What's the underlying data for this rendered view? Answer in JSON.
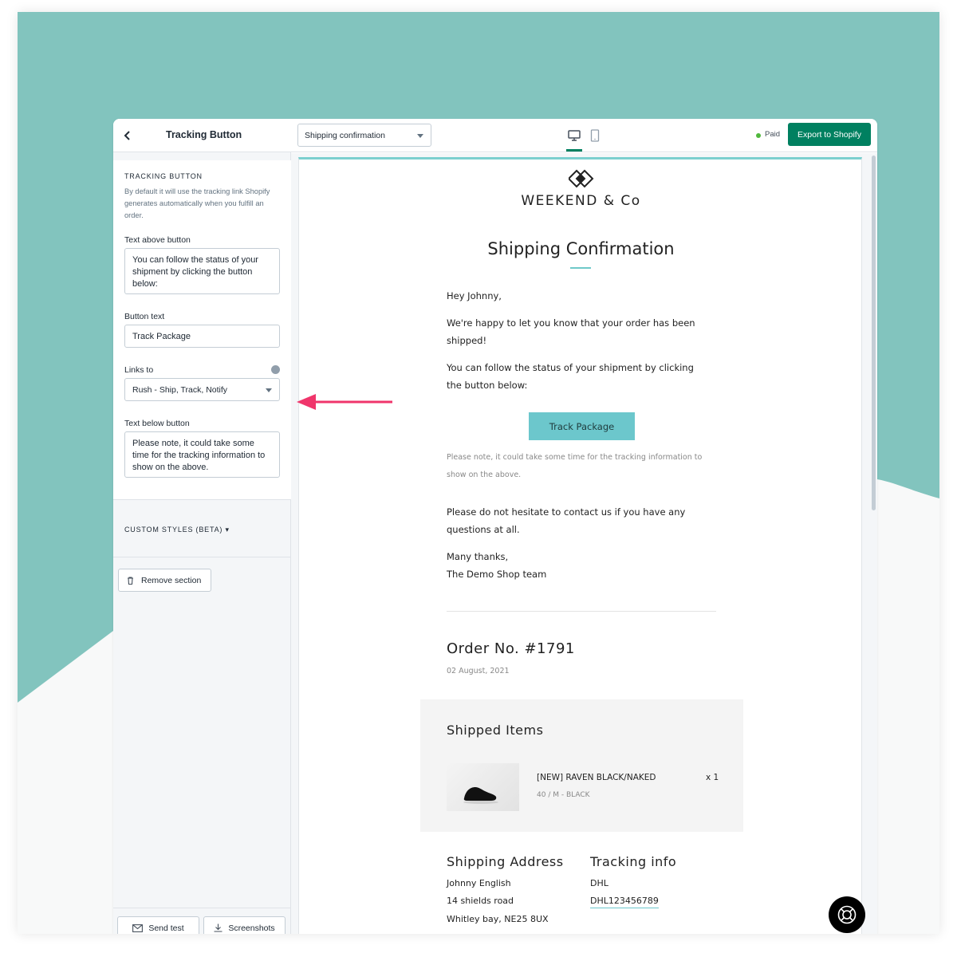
{
  "sidebar": {
    "title": "Tracking Button",
    "section_title": "TRACKING BUTTON",
    "section_desc": "By default it will use the tracking link Shopify generates automatically when you fulfill an order.",
    "text_above_label": "Text above button",
    "text_above_value": "You can follow the status of your shipment by clicking the button below:",
    "button_text_label": "Button text",
    "button_text_value": "Track Package",
    "links_to_label": "Links to",
    "links_to_value": "Rush - Ship, Track, Notify",
    "text_below_label": "Text below button",
    "text_below_value": "Please note, it could take some time for the tracking information to show on the above.",
    "custom_styles_label": "CUSTOM STYLES (BETA) ▾",
    "remove_section_label": "Remove section",
    "send_test_label": "Send test",
    "screenshots_label": "Screenshots"
  },
  "topbar": {
    "template_value": "Shipping confirmation",
    "status_text": "Paid",
    "export_label": "Export to Shopify"
  },
  "email": {
    "brand": "WEEKEND & Co",
    "heading": "Shipping Confirmation",
    "greeting": "Hey Johnny,",
    "intro": "We're happy to let you know that your order has been shipped!",
    "tracking_text": "You can follow the status of your shipment by clicking the button below:",
    "button_label": "Track Package",
    "note": "Please note, it could take some time for the tracking information to show on the above.",
    "contact": "Please do not hesitate to contact us if you have any questions at all.",
    "thanks": "Many thanks,",
    "signoff": "The Demo Shop team",
    "order_number": "Order No. #1791",
    "order_date": "02 August, 2021",
    "shipped_items_title": "Shipped Items",
    "item_name": "[NEW] RAVEN BLACK/NAKED",
    "item_meta": "40 / M - BLACK",
    "item_qty": "x 1",
    "shipping_address_title": "Shipping Address",
    "address_lines": [
      "Johnny English",
      "14 shields road",
      "Whitley bay, NE25 8UX"
    ],
    "tracking_info_title": "Tracking info",
    "carrier": "DHL",
    "tracking_number": "DHL123456789"
  },
  "colors": {
    "background_teal": "#82c4be",
    "primary_green": "#008060",
    "email_accent": "#6cc7cc",
    "annotation_arrow": "#f0356b"
  },
  "icons": [
    "back-chevron-icon",
    "desktop-view-icon",
    "mobile-view-icon",
    "trash-icon",
    "mail-icon",
    "download-icon",
    "help-lifebuoy-icon",
    "brand-logo-icon",
    "sneaker-image"
  ]
}
